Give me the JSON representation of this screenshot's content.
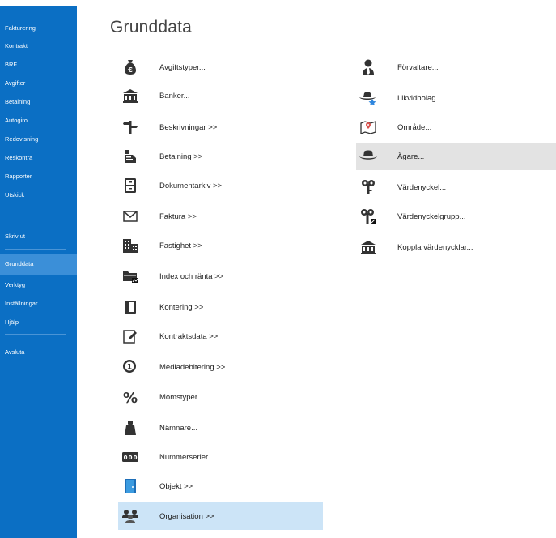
{
  "sidebar": {
    "items": [
      {
        "label": "Fakturering"
      },
      {
        "label": "Kontrakt"
      },
      {
        "label": "BRF"
      },
      {
        "label": "Avgifter"
      },
      {
        "label": "Betalning"
      },
      {
        "label": "Autogiro"
      },
      {
        "label": "Redovisning"
      },
      {
        "label": "Reskontra"
      },
      {
        "label": "Rapporter"
      },
      {
        "label": "Utskick"
      },
      {
        "label": "Skriv ut"
      },
      {
        "label": "Grunddata"
      },
      {
        "label": "Verktyg"
      },
      {
        "label": "Inställningar"
      },
      {
        "label": "Hjälp"
      },
      {
        "label": "Avsluta"
      }
    ],
    "active_item": "Grunddata",
    "background_color": "#0b6fc4",
    "active_color": "#3b8fd8"
  },
  "page": {
    "title": "Grunddata"
  },
  "menu_left": [
    {
      "label": "Avgiftstyper...",
      "icon": "money-bag-euro-icon"
    },
    {
      "label": "Banker...",
      "icon": "bank-icon"
    },
    {
      "label": "Beskrivningar >>",
      "icon": "signpost-icon"
    },
    {
      "label": "Betalning >>",
      "icon": "cash-register-icon"
    },
    {
      "label": "Dokumentarkiv >>",
      "icon": "file-cabinet-icon"
    },
    {
      "label": "Faktura >>",
      "icon": "envelope-icon"
    },
    {
      "label": "Fastighet >>",
      "icon": "buildings-icon"
    },
    {
      "label": "Index och ränta >>",
      "icon": "folder-chart-icon"
    },
    {
      "label": "Kontering >>",
      "icon": "ledger-book-icon"
    },
    {
      "label": "Kontraktsdata >>",
      "icon": "document-edit-icon"
    },
    {
      "label": "Mediadebitering >>",
      "icon": "meter-icon"
    },
    {
      "label": "Momstyper...",
      "icon": "percent-icon"
    },
    {
      "label": "Nämnare...",
      "icon": "weight-icon"
    },
    {
      "label": "Nummerserier...",
      "icon": "number-counter-icon"
    },
    {
      "label": "Objekt >>",
      "icon": "door-icon"
    },
    {
      "label": "Organisation >>",
      "icon": "people-group-icon"
    }
  ],
  "menu_right": [
    {
      "label": "Förvaltare...",
      "icon": "manager-person-icon"
    },
    {
      "label": "Likvidbolag...",
      "icon": "hat-star-icon"
    },
    {
      "label": "Område...",
      "icon": "map-pin-icon"
    },
    {
      "label": "Ägare...",
      "icon": "hat-icon"
    },
    {
      "label": "Värdenyckel...",
      "icon": "key-icon"
    },
    {
      "label": "Värdenyckelgrupp...",
      "icon": "key-group-icon"
    },
    {
      "label": "Koppla värdenycklar...",
      "icon": "bank-link-icon"
    }
  ],
  "selected_item": "Organisation >>",
  "hovered_item": "Ägare...",
  "colors": {
    "selected_bg": "#cce4f7",
    "hover_bg": "#e3e3e3",
    "icon_dark": "#333333"
  }
}
